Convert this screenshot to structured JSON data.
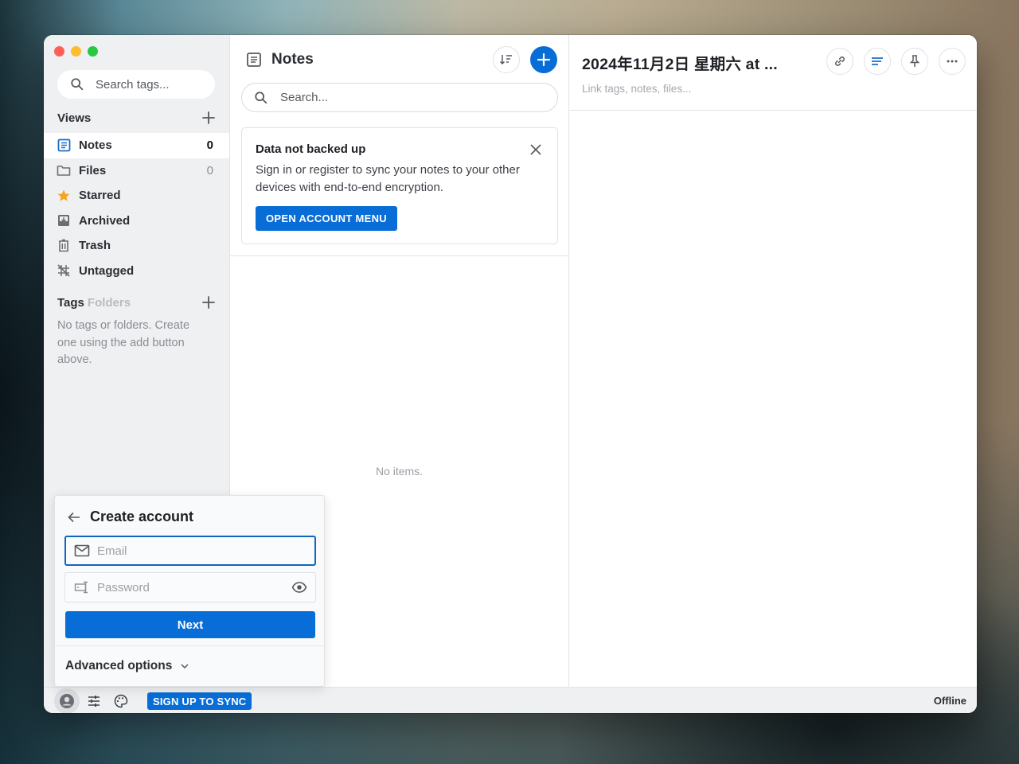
{
  "window": {
    "traffic_lights": [
      "close",
      "minimize",
      "maximize"
    ]
  },
  "sidebar": {
    "search_placeholder": "Search tags...",
    "views_label": "Views",
    "items": [
      {
        "label": "Notes",
        "count": "0",
        "icon": "notes-icon",
        "active": true
      },
      {
        "label": "Files",
        "count": "0",
        "icon": "folder-icon"
      },
      {
        "label": "Starred",
        "count": "",
        "icon": "star-icon"
      },
      {
        "label": "Archived",
        "count": "",
        "icon": "archive-icon"
      },
      {
        "label": "Trash",
        "count": "",
        "icon": "trash-icon"
      },
      {
        "label": "Untagged",
        "count": "",
        "icon": "untagged-icon"
      }
    ],
    "tags_label": "Tags",
    "folders_label": "Folders",
    "tags_empty": "No tags or folders. Create one using the add button above."
  },
  "notes": {
    "title": "Notes",
    "search_placeholder": "Search...",
    "banner": {
      "title": "Data not backed up",
      "text": "Sign in or register to sync your notes to your other devices with end-to-end encryption.",
      "button": "OPEN ACCOUNT MENU"
    },
    "empty": "No items."
  },
  "editor": {
    "title": "2024年11月2日 星期六 at ...",
    "links_placeholder": "Link tags, notes, files..."
  },
  "account_popover": {
    "title": "Create account",
    "email_placeholder": "Email",
    "password_placeholder": "Password",
    "next_label": "Next",
    "advanced_label": "Advanced options"
  },
  "footer": {
    "signup_label": "SIGN UP TO SYNC",
    "status": "Offline"
  },
  "colors": {
    "accent": "#086dd6",
    "star": "#f4a623"
  }
}
